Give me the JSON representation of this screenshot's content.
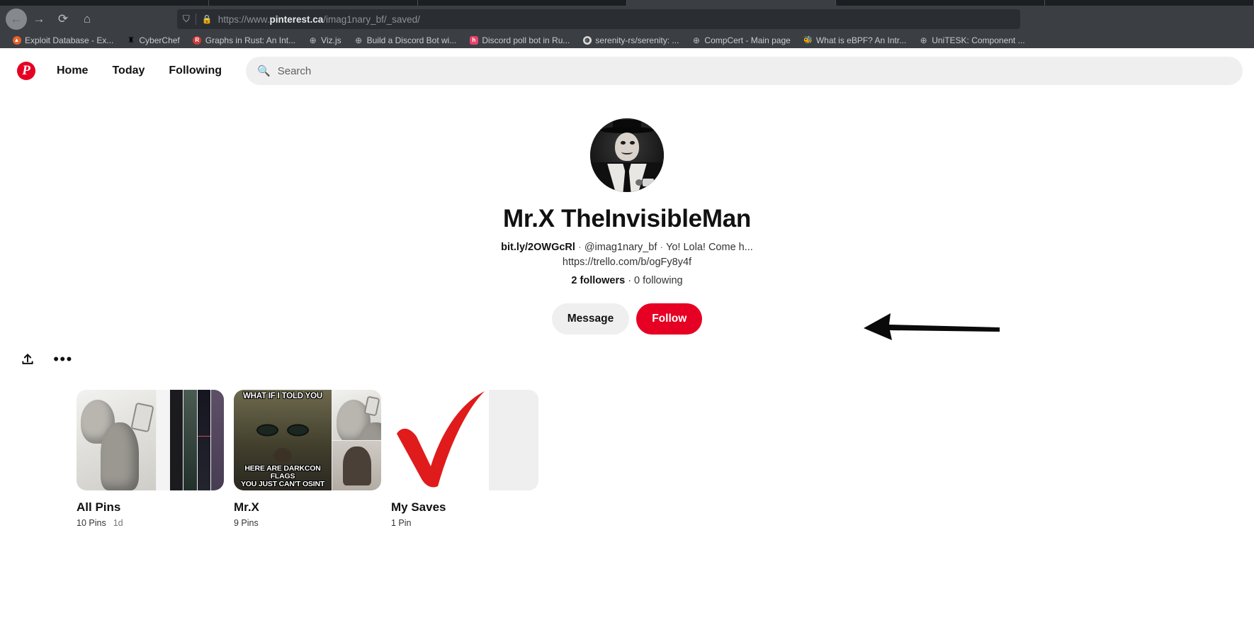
{
  "browser": {
    "nav": {
      "back_icon": "arrow-left-icon",
      "forward_icon": "arrow-right-icon",
      "reload_icon": "reload-icon",
      "home_icon": "home-icon"
    },
    "address_bar": {
      "shield_icon": "shield-icon",
      "lock_icon": "lock-icon",
      "scheme": "https://www.",
      "host": "pinterest.ca",
      "path": "/imag1nary_bf/_saved/",
      "full_url": "https://www.pinterest.ca/imag1nary_bf/_saved/"
    },
    "bookmarks": [
      {
        "label": "Exploit Database - Ex...",
        "icon": "exploitdb-icon",
        "color": "#e8622a"
      },
      {
        "label": "CyberChef",
        "icon": "cyberchef-icon",
        "color": "#dcdcdc"
      },
      {
        "label": "Graphs in Rust: An Int...",
        "icon": "rust-icon",
        "color": "#cf3b3b"
      },
      {
        "label": "Viz.js",
        "icon": "globe-icon",
        "color": "#b9bcbf"
      },
      {
        "label": "Build a Discord Bot wi...",
        "icon": "globe-icon",
        "color": "#b9bcbf"
      },
      {
        "label": "Discord poll bot in Ru...",
        "icon": "hashnode-icon",
        "color": "#e8436b"
      },
      {
        "label": "serenity-rs/serenity: ...",
        "icon": "github-icon",
        "color": "#d8d8d8"
      },
      {
        "label": "CompCert - Main page",
        "icon": "globe-icon",
        "color": "#b9bcbf"
      },
      {
        "label": "What is eBPF? An Intr...",
        "icon": "ebpf-icon",
        "color": "#4a6fa5"
      },
      {
        "label": "UniTESK: Component ...",
        "icon": "globe-icon",
        "color": "#b9bcbf"
      }
    ]
  },
  "pinterest": {
    "brand": {
      "logo_letter": "P",
      "accent_color": "#e60023"
    },
    "nav": [
      {
        "label": "Home",
        "name": "nav-home"
      },
      {
        "label": "Today",
        "name": "nav-today"
      },
      {
        "label": "Following",
        "name": "nav-following"
      }
    ],
    "search": {
      "icon": "search-icon",
      "placeholder": "Search",
      "value": ""
    },
    "profile": {
      "avatar_alt": "profile-avatar",
      "name": "Mr.X TheInvisibleMan",
      "bio_link": "bit.ly/2OWGcRl",
      "bio_separator_1": " · ",
      "bio_handle": "@imag1nary_bf",
      "bio_separator_2": " · ",
      "bio_text": "Yo! Lola! Come h...",
      "bio_line2": "https://trello.com/b/ogFy8y4f",
      "followers_count": "2 followers",
      "following_count": " · 0 following",
      "message_button": "Message",
      "follow_button": "Follow"
    },
    "board_toolbar": {
      "share_icon": "share-upload-icon",
      "more_icon": "more-options-icon"
    },
    "boards": [
      {
        "title": "All Pins",
        "pins": "10 Pins",
        "age": "1d",
        "thumb": "comic-selfie"
      },
      {
        "title": "Mr.X",
        "pins": "9 Pins",
        "age": "",
        "thumb": "morpheus-meme",
        "meme_top": "WHAT IF I TOLD YOU",
        "meme_bottom_1": "HERE ARE DARKCON FLAGS",
        "meme_bottom_2": "YOU JUST CAN'T OSINT"
      },
      {
        "title": "My Saves",
        "pins": "1 Pin",
        "age": "",
        "thumb": "red-checkmark"
      }
    ]
  }
}
